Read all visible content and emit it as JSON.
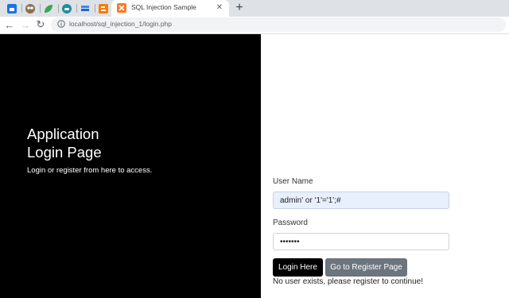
{
  "browser": {
    "pinned_tabs": [
      "blue-square-favicon",
      "owl-favicon",
      "green-leaf-favicon",
      "teal-cloud-favicon",
      "blue-stack-favicon",
      "orange-blogger-favicon"
    ],
    "active_tab": {
      "title": "SQL Injection Sample",
      "close_glyph": "✕"
    },
    "new_tab_glyph": "+",
    "back_glyph": "←",
    "forward_glyph": "→",
    "reload_glyph": "↻",
    "url": "localhost/sql_injection_1/login.php"
  },
  "hero": {
    "title_line1": "Application",
    "title_line2": "Login Page",
    "subtitle": "Login or register from here to access."
  },
  "form": {
    "username_label": "User Name",
    "username_value": "admin' or '1'='1';#",
    "password_label": "Password",
    "password_value": "passwor",
    "login_button": "Login Here",
    "register_button": "Go to Register Page",
    "message": "No user exists, please register to continue!"
  },
  "colors": {
    "hero_bg": "#000000",
    "login_button_bg": "#000000",
    "register_button_bg": "#6c757d",
    "autofill_bg": "#e8f0fe",
    "tabstrip_bg": "#dee1e6"
  }
}
